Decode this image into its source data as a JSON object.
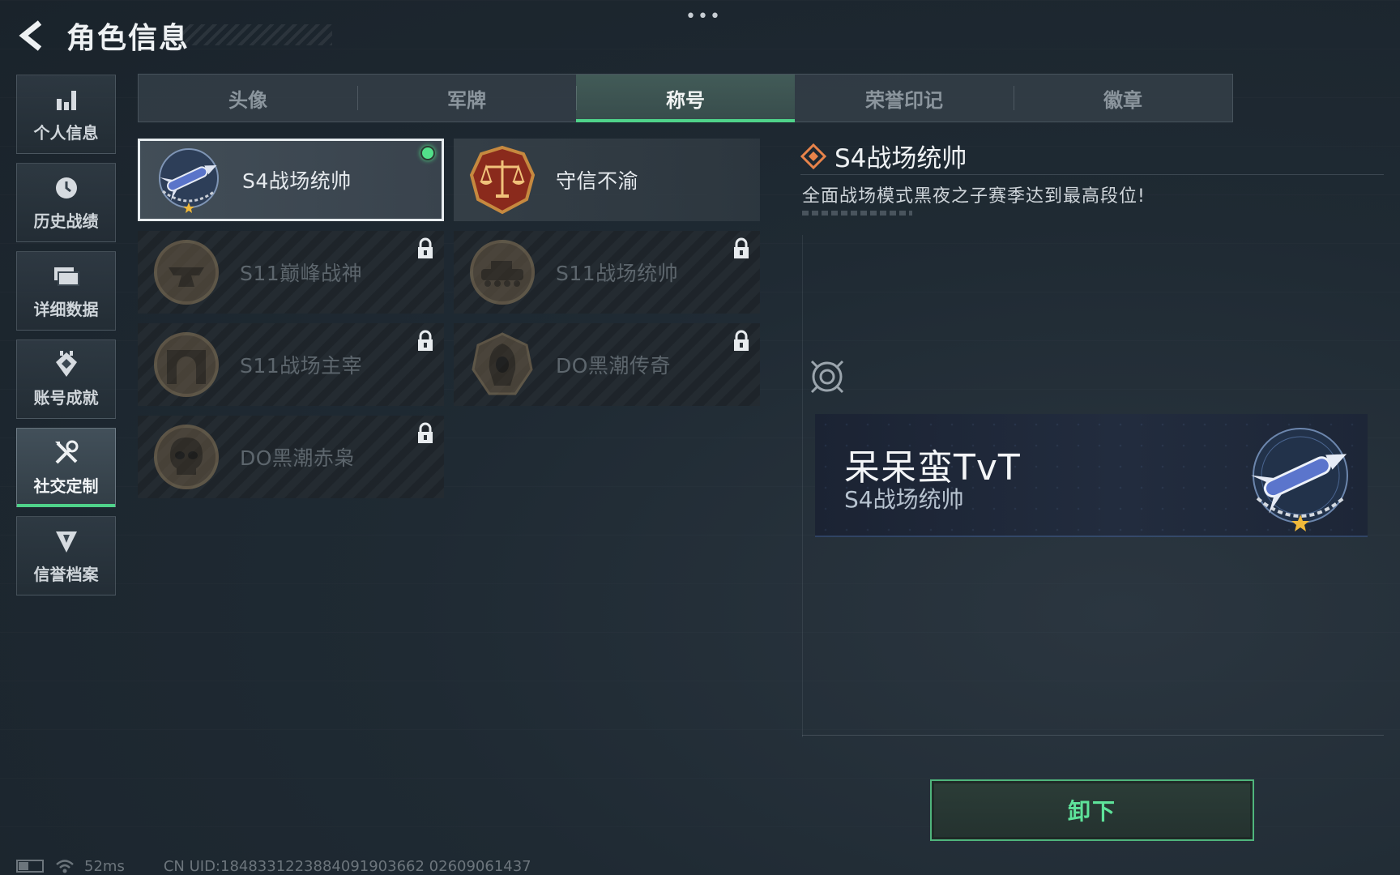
{
  "top_dots": "•••",
  "header": {
    "title": "角色信息"
  },
  "sidebar": {
    "items": [
      {
        "label": "个人信息",
        "icon": "bar-chart-icon"
      },
      {
        "label": "历史战绩",
        "icon": "clock-icon"
      },
      {
        "label": "详细数据",
        "icon": "folder-icon"
      },
      {
        "label": "账号成就",
        "icon": "achievement-icon"
      },
      {
        "label": "社交定制",
        "icon": "tools-icon",
        "active": true
      },
      {
        "label": "信誉档案",
        "icon": "shield-icon"
      }
    ]
  },
  "tabs": [
    {
      "label": "头像"
    },
    {
      "label": "军牌"
    },
    {
      "label": "称号",
      "active": true
    },
    {
      "label": "荣誉印记"
    },
    {
      "label": "徽章"
    }
  ],
  "titles": [
    {
      "name": "S4战场统帅",
      "emblem": "missile-emblem-icon",
      "selected": true,
      "equipped": true,
      "locked": false
    },
    {
      "name": "守信不渝",
      "emblem": "scales-emblem-icon",
      "locked": false
    },
    {
      "name": "S11巅峰战神",
      "emblem": "anvil-emblem-icon",
      "locked": true
    },
    {
      "name": "S11战场统帅",
      "emblem": "tank-emblem-icon",
      "locked": true
    },
    {
      "name": "S11战场主宰",
      "emblem": "arch-emblem-icon",
      "locked": true
    },
    {
      "name": "DO黑潮传奇",
      "emblem": "hooded-figure-emblem-icon",
      "locked": true
    },
    {
      "name": "DO黑潮赤枭",
      "emblem": "skull-emblem-icon",
      "locked": true
    }
  ],
  "detail": {
    "title": "S4战场统帅",
    "description": "全面战场模式黑夜之子赛季达到最高段位!"
  },
  "nameplate": {
    "player_name": "呆呆蛮TvT",
    "title": "S4战场统帅"
  },
  "actions": {
    "unequip_label": "卸下"
  },
  "status_bar": {
    "ping": "52ms",
    "uid": "CN UID:1848331223884091903662 02609061437"
  },
  "colors": {
    "accent_green": "#4fd38a",
    "equipped_dot": "#52e08a",
    "button_text": "#5ee39a"
  }
}
